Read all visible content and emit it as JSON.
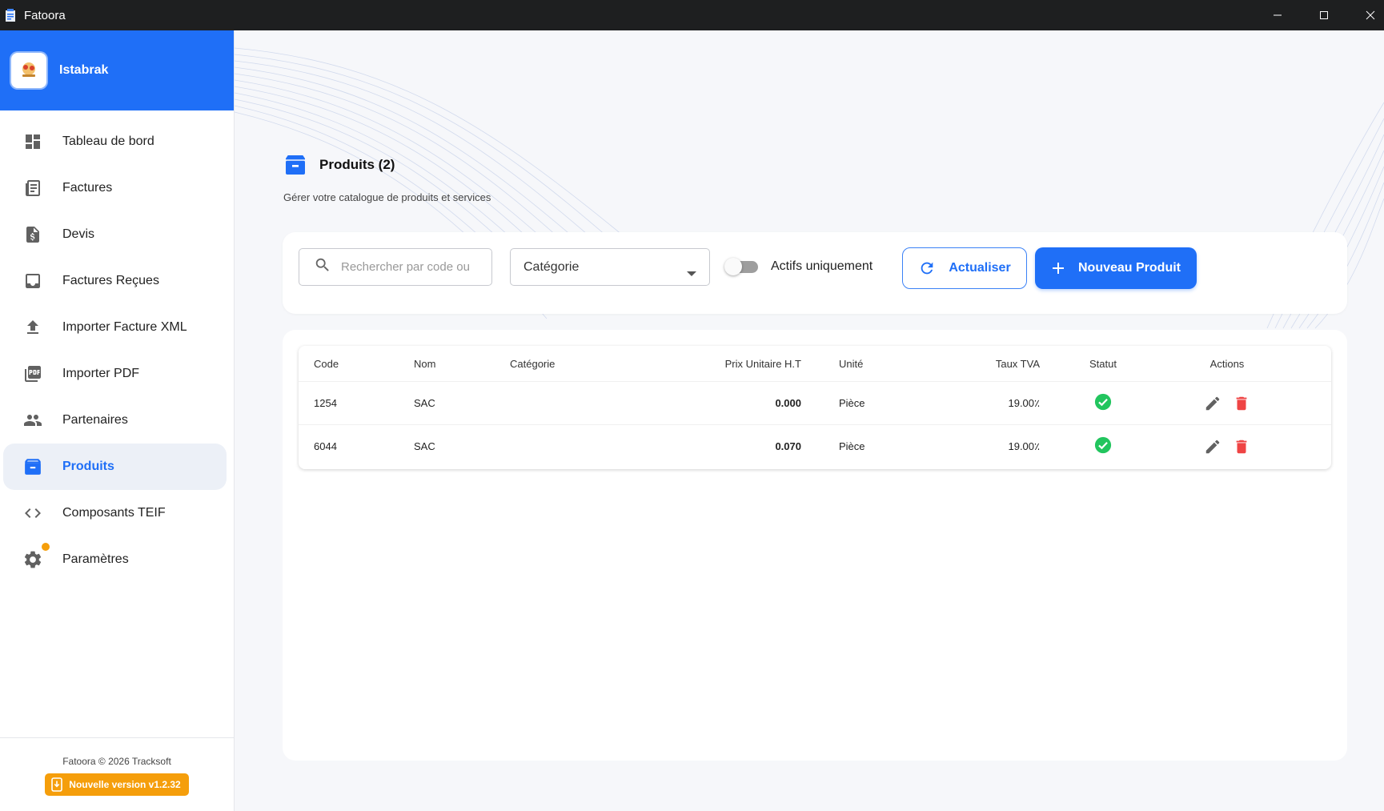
{
  "window": {
    "title": "Fatoora"
  },
  "sidebar": {
    "company_name": "Istabrak",
    "items": [
      {
        "label": "Tableau de bord",
        "icon": "dashboard-icon",
        "active": false
      },
      {
        "label": "Factures",
        "icon": "receipt-icon",
        "active": false
      },
      {
        "label": "Devis",
        "icon": "quote-file-icon",
        "active": false
      },
      {
        "label": "Factures Reçues",
        "icon": "inbox-icon",
        "active": false
      },
      {
        "label": "Importer Facture XML",
        "icon": "upload-icon",
        "active": false
      },
      {
        "label": "Importer PDF",
        "icon": "pdf-icon",
        "active": false
      },
      {
        "label": "Partenaires",
        "icon": "people-icon",
        "active": false
      },
      {
        "label": "Produits",
        "icon": "archive-box-icon",
        "active": true
      },
      {
        "label": "Composants TEIF",
        "icon": "code-icon",
        "active": false
      },
      {
        "label": "Paramètres",
        "icon": "gear-icon",
        "active": false
      }
    ],
    "footer": {
      "copyright": "Fatoora © 2026 Tracksoft",
      "version_badge": "Nouvelle version v1.2.32"
    }
  },
  "page": {
    "title": "Produits (2)",
    "subtitle": "Gérer votre catalogue de produits et services"
  },
  "toolbar": {
    "search_placeholder": "Rechercher par code ou",
    "category_select": "Catégorie",
    "active_only_label": "Actifs uniquement",
    "active_only_on": false,
    "refresh_label": "Actualiser",
    "new_product_label": "Nouveau Produit"
  },
  "table": {
    "columns": [
      "Code",
      "Nom",
      "Catégorie",
      "Prix Unitaire H.T",
      "Unité",
      "Taux TVA",
      "Statut",
      "Actions"
    ],
    "rows": [
      {
        "code": "1254",
        "nom": "SAC",
        "categorie": "",
        "prix": "0.000",
        "unite": "Pièce",
        "tva": "19.00٪",
        "statut": "active"
      },
      {
        "code": "6044",
        "nom": "SAC",
        "categorie": "",
        "prix": "0.070",
        "unite": "Pièce",
        "tva": "19.00٪",
        "statut": "active"
      }
    ]
  },
  "colors": {
    "primary": "#1f6ff7",
    "warning": "#f59e0b",
    "success": "#22c55e",
    "danger": "#ef4444",
    "titlebar": "#1e1f20"
  }
}
